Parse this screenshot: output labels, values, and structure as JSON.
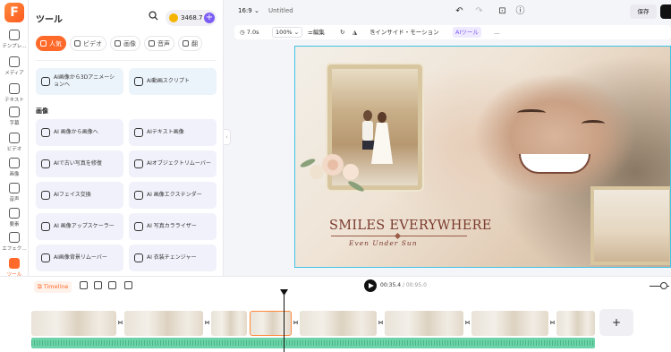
{
  "rail": {
    "logo": "F",
    "items": [
      {
        "label": "テンプレ…",
        "icon": "template-icon"
      },
      {
        "label": "メディア",
        "icon": "media-icon"
      },
      {
        "label": "テキスト",
        "icon": "text-icon"
      },
      {
        "label": "字幕",
        "icon": "subtitle-icon"
      },
      {
        "label": "ビデオ",
        "icon": "video-icon"
      },
      {
        "label": "画像",
        "icon": "image-icon"
      },
      {
        "label": "音声",
        "icon": "audio-icon"
      },
      {
        "label": "要素",
        "icon": "elements-icon"
      },
      {
        "label": "エフェク…",
        "icon": "effects-icon"
      },
      {
        "label": "ツール",
        "icon": "tools-icon",
        "active": true
      }
    ]
  },
  "panel": {
    "title": "ツール",
    "credits": "3468.7",
    "tabs": [
      {
        "label": "人気",
        "active": true
      },
      {
        "label": "ビデオ"
      },
      {
        "label": "画像"
      },
      {
        "label": "音声"
      },
      {
        "label": "翻"
      }
    ],
    "video_tools": [
      "AI画像から3Dアニメーションへ",
      "AI動画スクリプト"
    ],
    "image_section_label": "画像",
    "image_tools": [
      "AI 画像から画像へ",
      "AIテキスト画像",
      "AIで古い写真を修復",
      "AIオブジェクトリムーバー",
      "AIフェイス交換",
      "AI 画像エクステンダー",
      "AI 画像アップスケーラー",
      "AI 写真カラライザー",
      "AI画像背景リムーバー",
      "AI 衣装チェンジャー"
    ]
  },
  "topbar": {
    "ratio": "16:9",
    "title": "Untitled",
    "save": "保存"
  },
  "canvas_toolbar": {
    "duration": "7.0s",
    "zoom": "100%",
    "edit": "編集",
    "motion": "インサイド・モーション",
    "ai_tools": "AIツール",
    "more": "..."
  },
  "stage": {
    "title": "SMILES EVERYWHERE",
    "subtitle": "Even Under Sun",
    "accent_color": "#7a3a2e",
    "selection_color": "#3ec3e6"
  },
  "timeline": {
    "label": "Timeline",
    "current_time": "00:35.4",
    "total_time": "/ 00:95.0",
    "add": "+",
    "clip_count": 7,
    "audio_color": "#6dd3a8",
    "accent_color": "#ff6a2a"
  }
}
